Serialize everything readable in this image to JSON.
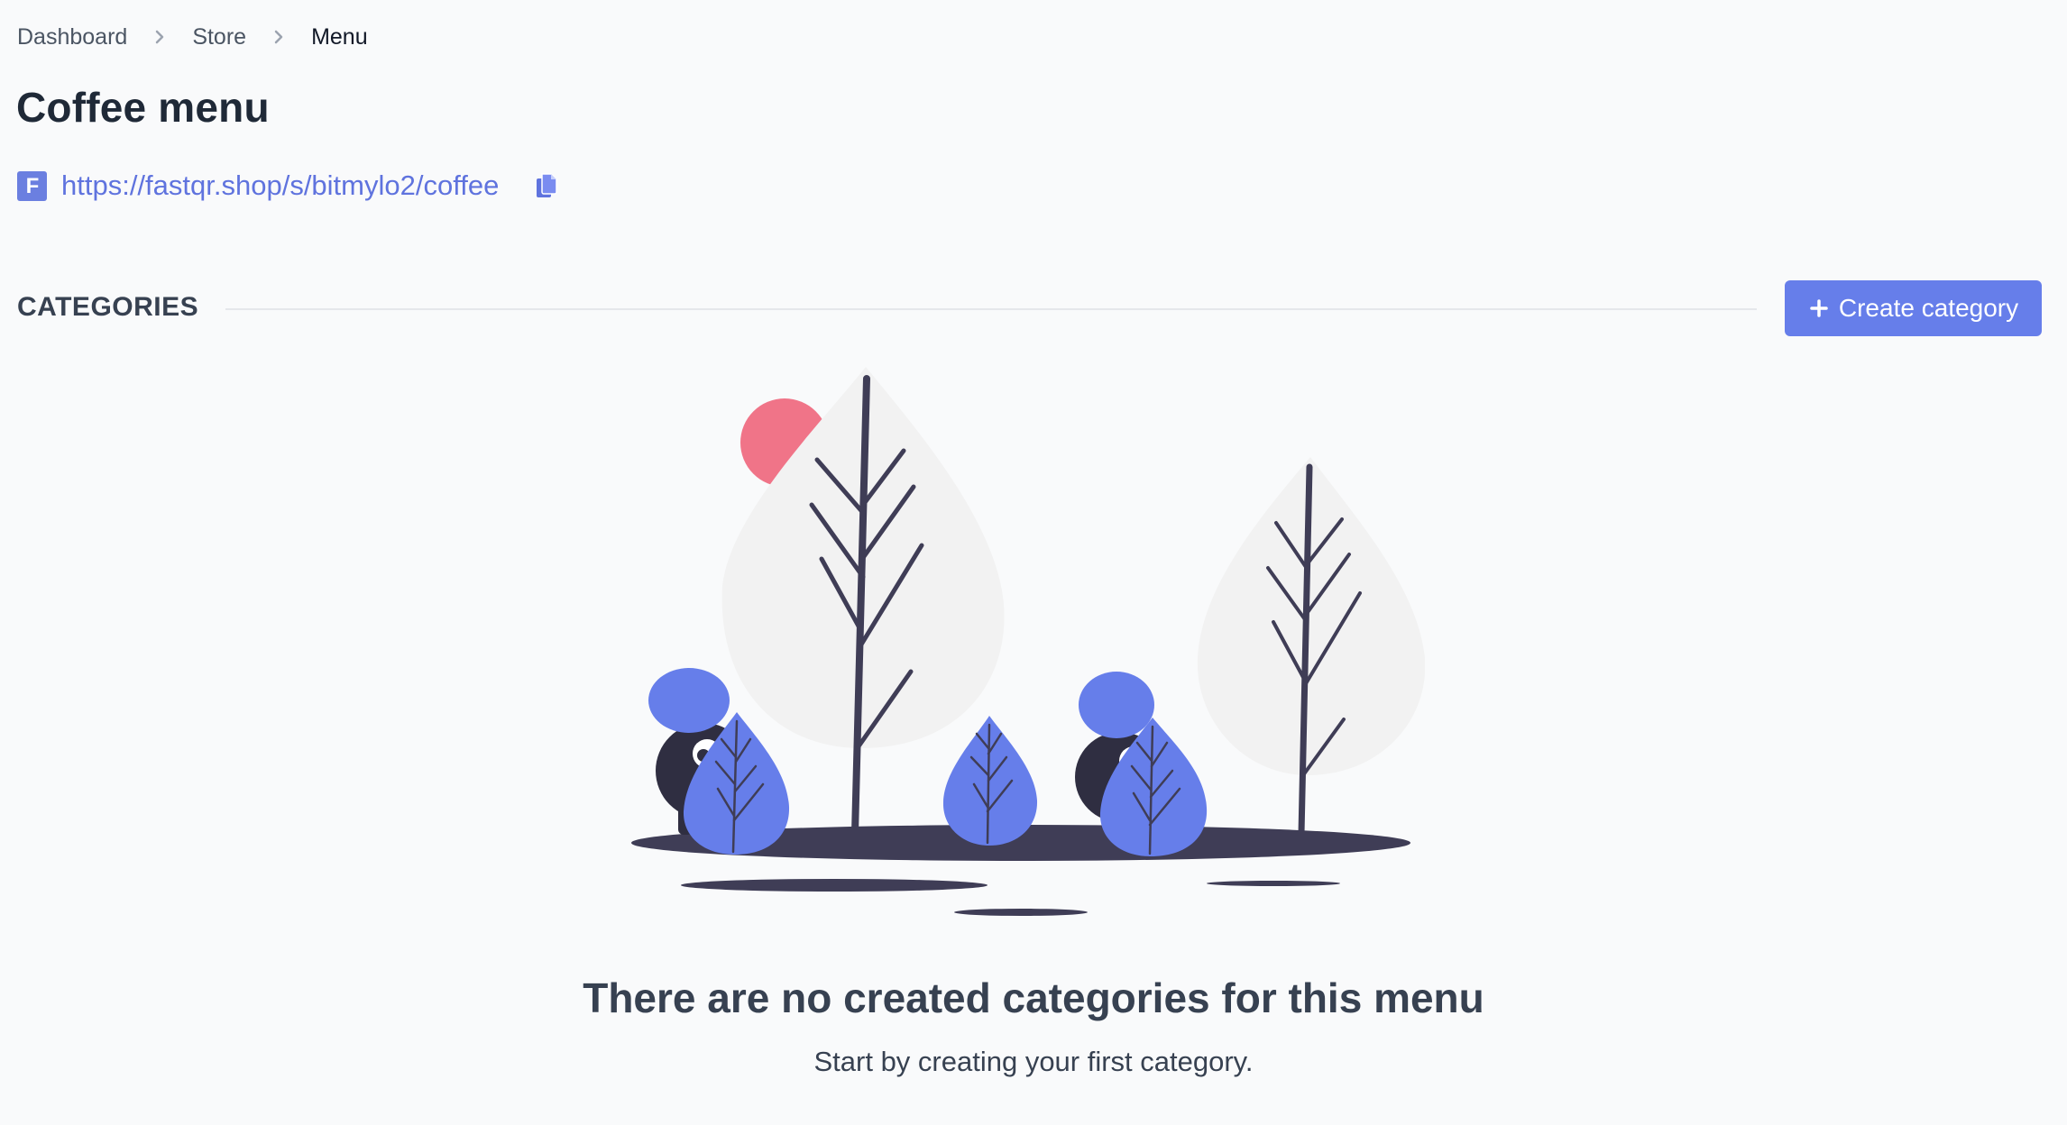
{
  "breadcrumb": {
    "items": [
      {
        "label": "Dashboard"
      },
      {
        "label": "Store"
      },
      {
        "label": "Menu"
      }
    ]
  },
  "page": {
    "title": "Coffee menu"
  },
  "store_link": {
    "favicon_letter": "F",
    "url": "https://fastqr.shop/s/bitmylo2/coffee",
    "copy_icon": "copy-icon"
  },
  "categories": {
    "heading": "CATEGORIES",
    "create_button_label": "Create category"
  },
  "empty_state": {
    "title": "There are no created categories for this menu",
    "subtitle": "Start by creating your first category."
  },
  "colors": {
    "accent": "#667eea",
    "link": "#5f73de",
    "tree": "#f2f2f2",
    "trunk": "#3f3d56",
    "sun": "#f07488",
    "figure": "#2f2e41"
  }
}
